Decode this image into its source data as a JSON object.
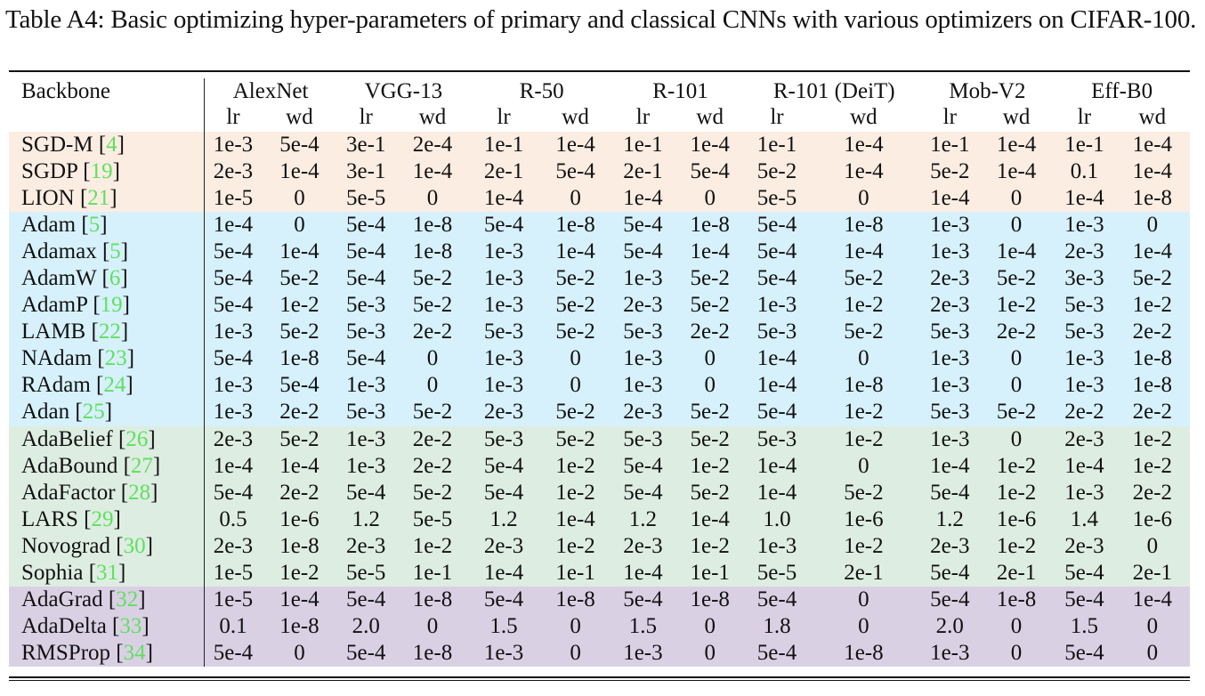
{
  "caption": "Table A4: Basic optimizing hyper-parameters of primary and classical CNNs with various optimizers on CIFAR-100.",
  "table": {
    "row_header_label": "Backbone",
    "backbones": [
      "AlexNet",
      "VGG-13",
      "R-50",
      "R-101",
      "R-101 (DeiT)",
      "Mob-V2",
      "Eff-B0"
    ],
    "subcolumns": [
      "lr",
      "wd"
    ],
    "group_colors": {
      "sgd": "#fcede2",
      "adam": "#d6f1fc",
      "adaptive": "#deede2",
      "adagrad": "#dad0e4"
    },
    "reference_color": "#5fe05f",
    "rows": [
      {
        "name": "SGD-M",
        "ref": "4",
        "group": "sgd",
        "values": [
          "1e-3",
          "5e-4",
          "3e-1",
          "2e-4",
          "1e-1",
          "1e-4",
          "1e-1",
          "1e-4",
          "1e-1",
          "1e-4",
          "1e-1",
          "1e-4",
          "1e-1",
          "1e-4"
        ]
      },
      {
        "name": "SGDP",
        "ref": "19",
        "group": "sgd",
        "values": [
          "2e-3",
          "1e-4",
          "3e-1",
          "1e-4",
          "2e-1",
          "5e-4",
          "2e-1",
          "5e-4",
          "5e-2",
          "1e-4",
          "5e-2",
          "1e-4",
          "0.1",
          "1e-4"
        ]
      },
      {
        "name": "LION",
        "ref": "21",
        "group": "sgd",
        "values": [
          "1e-5",
          "0",
          "5e-5",
          "0",
          "1e-4",
          "0",
          "1e-4",
          "0",
          "5e-5",
          "0",
          "1e-4",
          "0",
          "1e-4",
          "1e-8"
        ]
      },
      {
        "name": "Adam",
        "ref": "5",
        "group": "adam",
        "values": [
          "1e-4",
          "0",
          "5e-4",
          "1e-8",
          "5e-4",
          "1e-8",
          "5e-4",
          "1e-8",
          "5e-4",
          "1e-8",
          "1e-3",
          "0",
          "1e-3",
          "0"
        ]
      },
      {
        "name": "Adamax",
        "ref": "5",
        "group": "adam",
        "values": [
          "5e-4",
          "1e-4",
          "5e-4",
          "1e-8",
          "1e-3",
          "1e-4",
          "5e-4",
          "1e-4",
          "5e-4",
          "1e-4",
          "1e-3",
          "1e-4",
          "2e-3",
          "1e-4"
        ]
      },
      {
        "name": "AdamW",
        "ref": "6",
        "group": "adam",
        "values": [
          "5e-4",
          "5e-2",
          "5e-4",
          "5e-2",
          "1e-3",
          "5e-2",
          "1e-3",
          "5e-2",
          "5e-4",
          "5e-2",
          "2e-3",
          "5e-2",
          "3e-3",
          "5e-2"
        ]
      },
      {
        "name": "AdamP",
        "ref": "19",
        "group": "adam",
        "values": [
          "5e-4",
          "1e-2",
          "5e-3",
          "5e-2",
          "1e-3",
          "5e-2",
          "2e-3",
          "5e-2",
          "1e-3",
          "1e-2",
          "2e-3",
          "1e-2",
          "5e-3",
          "1e-2"
        ]
      },
      {
        "name": "LAMB",
        "ref": "22",
        "group": "adam",
        "values": [
          "1e-3",
          "5e-2",
          "5e-3",
          "2e-2",
          "5e-3",
          "5e-2",
          "5e-3",
          "2e-2",
          "5e-3",
          "5e-2",
          "5e-3",
          "2e-2",
          "5e-3",
          "2e-2"
        ]
      },
      {
        "name": "NAdam",
        "ref": "23",
        "group": "adam",
        "values": [
          "5e-4",
          "1e-8",
          "5e-4",
          "0",
          "1e-3",
          "0",
          "1e-3",
          "0",
          "1e-4",
          "0",
          "1e-3",
          "0",
          "1e-3",
          "1e-8"
        ]
      },
      {
        "name": "RAdam",
        "ref": "24",
        "group": "adam",
        "values": [
          "1e-3",
          "5e-4",
          "1e-3",
          "0",
          "1e-3",
          "0",
          "1e-3",
          "0",
          "1e-4",
          "1e-8",
          "1e-3",
          "0",
          "1e-3",
          "1e-8"
        ]
      },
      {
        "name": "Adan",
        "ref": "25",
        "group": "adam",
        "values": [
          "1e-3",
          "2e-2",
          "5e-3",
          "5e-2",
          "2e-3",
          "5e-2",
          "2e-3",
          "5e-2",
          "5e-4",
          "1e-2",
          "5e-3",
          "5e-2",
          "2e-2",
          "2e-2"
        ]
      },
      {
        "name": "AdaBelief",
        "ref": "26",
        "group": "adaptive",
        "values": [
          "2e-3",
          "5e-2",
          "1e-3",
          "2e-2",
          "5e-3",
          "5e-2",
          "5e-3",
          "5e-2",
          "5e-3",
          "1e-2",
          "1e-3",
          "0",
          "2e-3",
          "1e-2"
        ]
      },
      {
        "name": "AdaBound",
        "ref": "27",
        "group": "adaptive",
        "values": [
          "1e-4",
          "1e-4",
          "1e-3",
          "2e-2",
          "5e-4",
          "1e-2",
          "5e-4",
          "1e-2",
          "1e-4",
          "0",
          "1e-4",
          "1e-2",
          "1e-4",
          "1e-2"
        ]
      },
      {
        "name": "AdaFactor",
        "ref": "28",
        "group": "adaptive",
        "values": [
          "5e-4",
          "2e-2",
          "5e-4",
          "5e-2",
          "5e-4",
          "1e-2",
          "5e-4",
          "5e-2",
          "1e-4",
          "5e-2",
          "5e-4",
          "1e-2",
          "1e-3",
          "2e-2"
        ]
      },
      {
        "name": "LARS",
        "ref": "29",
        "group": "adaptive",
        "values": [
          "0.5",
          "1e-6",
          "1.2",
          "5e-5",
          "1.2",
          "1e-4",
          "1.2",
          "1e-4",
          "1.0",
          "1e-6",
          "1.2",
          "1e-6",
          "1.4",
          "1e-6"
        ]
      },
      {
        "name": "Novograd",
        "ref": "30",
        "group": "adaptive",
        "values": [
          "2e-3",
          "1e-8",
          "2e-3",
          "1e-2",
          "2e-3",
          "1e-2",
          "2e-3",
          "1e-2",
          "1e-3",
          "1e-2",
          "2e-3",
          "1e-2",
          "2e-3",
          "0"
        ]
      },
      {
        "name": "Sophia",
        "ref": "31",
        "group": "adaptive",
        "values": [
          "1e-5",
          "1e-2",
          "5e-5",
          "1e-1",
          "1e-4",
          "1e-1",
          "1e-4",
          "1e-1",
          "5e-5",
          "2e-1",
          "5e-4",
          "2e-1",
          "5e-4",
          "2e-1"
        ]
      },
      {
        "name": "AdaGrad",
        "ref": "32",
        "group": "adagrad",
        "values": [
          "1e-5",
          "1e-4",
          "5e-4",
          "1e-8",
          "5e-4",
          "1e-8",
          "5e-4",
          "1e-8",
          "5e-4",
          "0",
          "5e-4",
          "1e-8",
          "5e-4",
          "1e-4"
        ]
      },
      {
        "name": "AdaDelta",
        "ref": "33",
        "group": "adagrad",
        "values": [
          "0.1",
          "1e-8",
          "2.0",
          "0",
          "1.5",
          "0",
          "1.5",
          "0",
          "1.8",
          "0",
          "2.0",
          "0",
          "1.5",
          "0"
        ]
      },
      {
        "name": "RMSProp",
        "ref": "34",
        "group": "adagrad",
        "values": [
          "5e-4",
          "0",
          "5e-4",
          "1e-8",
          "1e-3",
          "0",
          "1e-3",
          "0",
          "5e-4",
          "1e-8",
          "1e-3",
          "0",
          "5e-4",
          "0"
        ]
      }
    ]
  }
}
